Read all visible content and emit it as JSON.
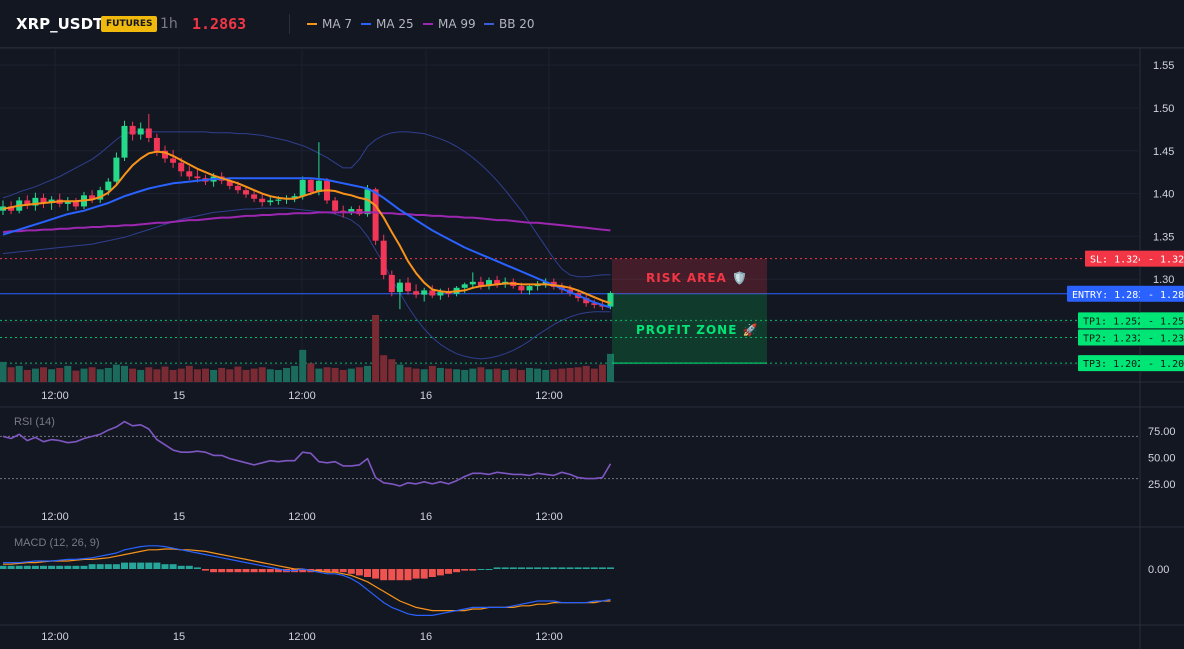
{
  "header": {
    "symbol": "XRP_USDT",
    "badge": "FUTURES",
    "timeframe": "1h",
    "price": "1.2863",
    "indicators": [
      {
        "label": "MA 7",
        "color": "#f7931a"
      },
      {
        "label": "MA 25",
        "color": "#2962ff"
      },
      {
        "label": "MA 99",
        "color": "#9c27b0"
      },
      {
        "label": "BB 20",
        "color": "#1e3a8a"
      }
    ]
  },
  "main_axis": {
    "ticks": [
      "1.55",
      "1.50",
      "1.45",
      "1.40",
      "1.35",
      "1.30",
      "1.25",
      "1.20"
    ]
  },
  "time_axis": {
    "ticks": [
      "12:00",
      "15",
      "12:00",
      "16",
      "12:00"
    ]
  },
  "levels": {
    "sl": {
      "tag": "SL: 1.324",
      "value": 1.324,
      "axis": "1.32",
      "color": "#f23645"
    },
    "entry": {
      "tag": "ENTRY: 1.283",
      "value": 1.283,
      "axis": "1.28",
      "color": "#2962ff"
    },
    "tp1": {
      "tag": "TP1: 1.252",
      "value": 1.252,
      "axis": "1.25",
      "color": "#00e676"
    },
    "tp2": {
      "tag": "TP2: 1.232",
      "value": 1.232,
      "axis": "1.23",
      "color": "#00e676"
    },
    "tp3": {
      "tag": "TP3: 1.202",
      "value": 1.202,
      "axis": "1.20",
      "color": "#00e676"
    }
  },
  "zones": {
    "risk_label": "RISK AREA 🛡️",
    "profit_label": "PROFIT ZONE 🚀"
  },
  "rsi": {
    "title": "RSI (14)",
    "ticks": [
      "75.00",
      "50.00",
      "25.00"
    ]
  },
  "macd": {
    "title": "MACD (12, 26, 9)",
    "ticks": [
      "0.00"
    ]
  },
  "chart_data": {
    "type": "candlestick",
    "candles": [
      [
        1.38,
        1.392,
        1.375,
        1.385
      ],
      [
        1.385,
        1.391,
        1.376,
        1.38
      ],
      [
        1.38,
        1.396,
        1.377,
        1.392
      ],
      [
        1.392,
        1.398,
        1.382,
        1.386
      ],
      [
        1.386,
        1.401,
        1.38,
        1.395
      ],
      [
        1.395,
        1.4,
        1.383,
        1.389
      ],
      [
        1.389,
        1.397,
        1.381,
        1.393
      ],
      [
        1.393,
        1.4,
        1.384,
        1.388
      ],
      [
        1.388,
        1.396,
        1.38,
        1.391
      ],
      [
        1.391,
        1.395,
        1.381,
        1.385
      ],
      [
        1.385,
        1.402,
        1.382,
        1.398
      ],
      [
        1.398,
        1.404,
        1.389,
        1.393
      ],
      [
        1.393,
        1.408,
        1.389,
        1.404
      ],
      [
        1.404,
        1.418,
        1.398,
        1.414
      ],
      [
        1.414,
        1.448,
        1.41,
        1.442
      ],
      [
        1.442,
        1.485,
        1.438,
        1.479
      ],
      [
        1.479,
        1.484,
        1.462,
        1.469
      ],
      [
        1.469,
        1.483,
        1.463,
        1.476
      ],
      [
        1.476,
        1.493,
        1.46,
        1.465
      ],
      [
        1.465,
        1.47,
        1.444,
        1.45
      ],
      [
        1.45,
        1.456,
        1.436,
        1.441
      ],
      [
        1.441,
        1.451,
        1.43,
        1.436
      ],
      [
        1.436,
        1.442,
        1.42,
        1.426
      ],
      [
        1.426,
        1.432,
        1.416,
        1.42
      ],
      [
        1.42,
        1.428,
        1.413,
        1.418
      ],
      [
        1.418,
        1.422,
        1.41,
        1.414
      ],
      [
        1.414,
        1.424,
        1.408,
        1.42
      ],
      [
        1.42,
        1.425,
        1.411,
        1.415
      ],
      [
        1.415,
        1.419,
        1.405,
        1.409
      ],
      [
        1.409,
        1.414,
        1.4,
        1.404
      ],
      [
        1.404,
        1.409,
        1.395,
        1.399
      ],
      [
        1.399,
        1.404,
        1.39,
        1.394
      ],
      [
        1.394,
        1.4,
        1.385,
        1.39
      ],
      [
        1.39,
        1.396,
        1.386,
        1.392
      ],
      [
        1.392,
        1.397,
        1.387,
        1.393
      ],
      [
        1.393,
        1.398,
        1.388,
        1.395
      ],
      [
        1.395,
        1.4,
        1.39,
        1.397
      ],
      [
        1.397,
        1.42,
        1.393,
        1.416
      ],
      [
        1.416,
        1.418,
        1.398,
        1.402
      ],
      [
        1.402,
        1.46,
        1.398,
        1.415
      ],
      [
        1.415,
        1.418,
        1.388,
        1.392
      ],
      [
        1.392,
        1.396,
        1.376,
        1.38
      ],
      [
        1.38,
        1.386,
        1.372,
        1.378
      ],
      [
        1.378,
        1.385,
        1.375,
        1.382
      ],
      [
        1.382,
        1.386,
        1.374,
        1.376
      ],
      [
        1.376,
        1.41,
        1.373,
        1.405
      ],
      [
        1.405,
        1.407,
        1.34,
        1.345
      ],
      [
        1.345,
        1.352,
        1.3,
        1.305
      ],
      [
        1.305,
        1.31,
        1.28,
        1.285
      ],
      [
        1.285,
        1.3,
        1.265,
        1.296
      ],
      [
        1.296,
        1.302,
        1.282,
        1.286
      ],
      [
        1.286,
        1.294,
        1.278,
        1.282
      ],
      [
        1.282,
        1.29,
        1.274,
        1.287
      ],
      [
        1.287,
        1.293,
        1.278,
        1.281
      ],
      [
        1.281,
        1.289,
        1.276,
        1.285
      ],
      [
        1.285,
        1.29,
        1.279,
        1.283
      ],
      [
        1.283,
        1.292,
        1.28,
        1.29
      ],
      [
        1.29,
        1.296,
        1.284,
        1.294
      ],
      [
        1.294,
        1.308,
        1.29,
        1.297
      ],
      [
        1.297,
        1.303,
        1.288,
        1.292
      ],
      [
        1.292,
        1.302,
        1.288,
        1.299
      ],
      [
        1.299,
        1.304,
        1.29,
        1.294
      ],
      [
        1.294,
        1.302,
        1.29,
        1.297
      ],
      [
        1.297,
        1.301,
        1.289,
        1.292
      ],
      [
        1.292,
        1.296,
        1.283,
        1.287
      ],
      [
        1.287,
        1.295,
        1.282,
        1.292
      ],
      [
        1.292,
        1.298,
        1.287,
        1.295
      ],
      [
        1.295,
        1.301,
        1.29,
        1.297
      ],
      [
        1.297,
        1.301,
        1.288,
        1.291
      ],
      [
        1.291,
        1.296,
        1.284,
        1.288
      ],
      [
        1.288,
        1.293,
        1.28,
        1.284
      ],
      [
        1.284,
        1.288,
        1.274,
        1.278
      ],
      [
        1.278,
        1.282,
        1.268,
        1.272
      ],
      [
        1.272,
        1.276,
        1.266,
        1.27
      ],
      [
        1.27,
        1.275,
        1.264,
        1.268
      ],
      [
        1.268,
        1.286,
        1.265,
        1.284
      ]
    ],
    "ma7": [
      1.382,
      1.384,
      1.386,
      1.387,
      1.388,
      1.389,
      1.39,
      1.391,
      1.391,
      1.391,
      1.392,
      1.393,
      1.396,
      1.401,
      1.41,
      1.422,
      1.433,
      1.441,
      1.447,
      1.449,
      1.448,
      1.444,
      1.439,
      1.434,
      1.429,
      1.425,
      1.421,
      1.418,
      1.415,
      1.412,
      1.408,
      1.404,
      1.4,
      1.397,
      1.395,
      1.394,
      1.394,
      1.397,
      1.4,
      1.403,
      1.404,
      1.403,
      1.4,
      1.398,
      1.395,
      1.393,
      1.386,
      1.372,
      1.355,
      1.339,
      1.321,
      1.307,
      1.296,
      1.288,
      1.286,
      1.285,
      1.286,
      1.287,
      1.29,
      1.292,
      1.293,
      1.294,
      1.295,
      1.295,
      1.294,
      1.294,
      1.294,
      1.294,
      1.293,
      1.292,
      1.29,
      1.287,
      1.283,
      1.279,
      1.275,
      1.272
    ],
    "ma25": [
      1.352,
      1.355,
      1.358,
      1.361,
      1.364,
      1.367,
      1.37,
      1.373,
      1.376,
      1.378,
      1.38,
      1.383,
      1.386,
      1.389,
      1.393,
      1.397,
      1.4,
      1.403,
      1.406,
      1.408,
      1.41,
      1.412,
      1.413,
      1.414,
      1.415,
      1.416,
      1.417,
      1.417,
      1.418,
      1.418,
      1.418,
      1.418,
      1.418,
      1.418,
      1.418,
      1.418,
      1.418,
      1.418,
      1.418,
      1.417,
      1.416,
      1.414,
      1.412,
      1.41,
      1.408,
      1.406,
      1.401,
      1.395,
      1.388,
      1.381,
      1.375,
      1.369,
      1.363,
      1.357,
      1.352,
      1.347,
      1.342,
      1.337,
      1.333,
      1.329,
      1.325,
      1.321,
      1.317,
      1.313,
      1.309,
      1.305,
      1.301,
      1.297,
      1.293,
      1.289,
      1.285,
      1.281,
      1.277,
      1.273,
      1.27,
      1.267
    ],
    "ma99": [
      1.355,
      1.356,
      1.356,
      1.357,
      1.357,
      1.358,
      1.358,
      1.359,
      1.359,
      1.36,
      1.36,
      1.361,
      1.361,
      1.362,
      1.362,
      1.363,
      1.363,
      1.364,
      1.365,
      1.366,
      1.366,
      1.367,
      1.368,
      1.369,
      1.369,
      1.37,
      1.371,
      1.372,
      1.372,
      1.373,
      1.374,
      1.374,
      1.375,
      1.375,
      1.376,
      1.376,
      1.377,
      1.377,
      1.377,
      1.378,
      1.378,
      1.378,
      1.378,
      1.378,
      1.378,
      1.378,
      1.378,
      1.377,
      1.377,
      1.376,
      1.376,
      1.375,
      1.375,
      1.374,
      1.374,
      1.373,
      1.373,
      1.372,
      1.372,
      1.371,
      1.37,
      1.369,
      1.369,
      1.368,
      1.367,
      1.366,
      1.366,
      1.365,
      1.364,
      1.363,
      1.362,
      1.361,
      1.36,
      1.359,
      1.358,
      1.357
    ],
    "bb_upper": [
      1.395,
      1.398,
      1.402,
      1.405,
      1.408,
      1.412,
      1.416,
      1.42,
      1.425,
      1.43,
      1.435,
      1.44,
      1.447,
      1.455,
      1.463,
      1.47,
      1.472,
      1.472,
      1.472,
      1.472,
      1.472,
      1.472,
      1.472,
      1.472,
      1.472,
      1.472,
      1.471,
      1.471,
      1.471,
      1.47,
      1.47,
      1.469,
      1.468,
      1.466,
      1.464,
      1.462,
      1.459,
      1.456,
      1.452,
      1.447,
      1.442,
      1.436,
      1.43,
      1.43,
      1.44,
      1.455,
      1.463,
      1.468,
      1.471,
      1.472,
      1.472,
      1.471,
      1.47,
      1.467,
      1.464,
      1.46,
      1.455,
      1.449,
      1.442,
      1.434,
      1.425,
      1.415,
      1.404,
      1.392,
      1.38,
      1.366,
      1.352,
      1.338,
      1.324,
      1.312,
      1.305,
      1.303,
      1.303,
      1.304,
      1.305,
      1.305
    ],
    "bb_lower": [
      1.33,
      1.331,
      1.332,
      1.333,
      1.334,
      1.335,
      1.336,
      1.337,
      1.338,
      1.339,
      1.34,
      1.341,
      1.343,
      1.345,
      1.347,
      1.349,
      1.352,
      1.355,
      1.358,
      1.361,
      1.364,
      1.367,
      1.37,
      1.372,
      1.374,
      1.376,
      1.378,
      1.379,
      1.38,
      1.381,
      1.382,
      1.382,
      1.383,
      1.383,
      1.383,
      1.383,
      1.382,
      1.381,
      1.38,
      1.379,
      1.378,
      1.376,
      1.373,
      1.369,
      1.362,
      1.35,
      1.334,
      1.318,
      1.3,
      1.284,
      1.268,
      1.254,
      1.242,
      1.232,
      1.224,
      1.218,
      1.213,
      1.21,
      1.208,
      1.207,
      1.208,
      1.21,
      1.213,
      1.217,
      1.222,
      1.228,
      1.235,
      1.241,
      1.247,
      1.252,
      1.256,
      1.259,
      1.261,
      1.262,
      1.262,
      1.262
    ],
    "volume": [
      0.3,
      0.22,
      0.24,
      0.18,
      0.2,
      0.22,
      0.19,
      0.21,
      0.24,
      0.17,
      0.2,
      0.22,
      0.19,
      0.21,
      0.26,
      0.24,
      0.2,
      0.18,
      0.22,
      0.19,
      0.23,
      0.18,
      0.2,
      0.24,
      0.19,
      0.2,
      0.18,
      0.21,
      0.19,
      0.23,
      0.18,
      0.2,
      0.22,
      0.19,
      0.18,
      0.21,
      0.24,
      0.48,
      0.28,
      0.2,
      0.22,
      0.21,
      0.18,
      0.2,
      0.22,
      0.24,
      1.0,
      0.4,
      0.34,
      0.26,
      0.22,
      0.2,
      0.19,
      0.24,
      0.21,
      0.2,
      0.19,
      0.18,
      0.2,
      0.22,
      0.19,
      0.2,
      0.18,
      0.2,
      0.18,
      0.21,
      0.2,
      0.18,
      0.19,
      0.2,
      0.21,
      0.22,
      0.24,
      0.2,
      0.26,
      0.42
    ],
    "rsi": [
      70,
      68,
      72,
      66,
      69,
      65,
      67,
      66,
      64,
      65,
      68,
      70,
      72,
      76,
      79,
      84,
      80,
      81,
      77,
      67,
      62,
      57,
      55,
      55,
      56,
      55,
      52,
      52,
      49,
      47,
      45,
      43,
      45,
      47,
      46,
      47,
      47,
      55,
      54,
      46,
      45,
      46,
      42,
      42,
      43,
      49,
      31,
      26,
      25,
      23,
      26,
      25,
      27,
      25,
      27,
      25,
      28,
      32,
      35,
      35,
      34,
      36,
      35,
      34,
      34,
      33,
      35,
      34,
      33,
      36,
      34,
      31,
      30,
      30,
      31,
      44
    ],
    "macd": [
      0.004,
      0.004,
      0.004,
      0.0045,
      0.005,
      0.005,
      0.005,
      0.0055,
      0.006,
      0.006,
      0.0065,
      0.007,
      0.008,
      0.009,
      0.01,
      0.012,
      0.013,
      0.014,
      0.0145,
      0.0145,
      0.014,
      0.013,
      0.012,
      0.011,
      0.01,
      0.009,
      0.008,
      0.007,
      0.006,
      0.005,
      0.004,
      0.003,
      0.002,
      0.001,
      0.0,
      -0.001,
      -0.001,
      0.0,
      -0.001,
      -0.002,
      -0.003,
      -0.003,
      -0.004,
      -0.006,
      -0.009,
      -0.013,
      -0.017,
      -0.021,
      -0.024,
      -0.026,
      -0.028,
      -0.029,
      -0.029,
      -0.029,
      -0.028,
      -0.027,
      -0.026,
      -0.025,
      -0.024,
      -0.024,
      -0.024,
      -0.024,
      -0.024,
      -0.023,
      -0.022,
      -0.021,
      -0.02,
      -0.02,
      -0.02,
      -0.021,
      -0.021,
      -0.021,
      -0.021,
      -0.02,
      -0.02,
      -0.019
    ],
    "signal": [
      0.003,
      0.003,
      0.0035,
      0.004,
      0.004,
      0.0045,
      0.005,
      0.005,
      0.005,
      0.0055,
      0.006,
      0.006,
      0.0065,
      0.007,
      0.008,
      0.009,
      0.01,
      0.011,
      0.012,
      0.012,
      0.0125,
      0.0125,
      0.012,
      0.012,
      0.0115,
      0.011,
      0.01,
      0.009,
      0.008,
      0.007,
      0.006,
      0.005,
      0.004,
      0.003,
      0.002,
      0.001,
      0.0,
      0.0,
      -0.001,
      -0.001,
      -0.002,
      -0.002,
      -0.003,
      -0.004,
      -0.006,
      -0.008,
      -0.011,
      -0.014,
      -0.017,
      -0.02,
      -0.022,
      -0.024,
      -0.025,
      -0.026,
      -0.026,
      -0.026,
      -0.026,
      -0.026,
      -0.025,
      -0.025,
      -0.024,
      -0.024,
      -0.024,
      -0.024,
      -0.023,
      -0.023,
      -0.022,
      -0.022,
      -0.021,
      -0.021,
      -0.021,
      -0.021,
      -0.021,
      -0.021,
      -0.02,
      -0.02
    ],
    "hist": [
      0.002,
      0.002,
      0.002,
      0.002,
      0.002,
      0.002,
      0.002,
      0.002,
      0.002,
      0.002,
      0.002,
      0.003,
      0.003,
      0.003,
      0.003,
      0.004,
      0.004,
      0.004,
      0.004,
      0.004,
      0.003,
      0.003,
      0.002,
      0.002,
      0.001,
      -0.001,
      -0.002,
      -0.002,
      -0.002,
      -0.002,
      -0.002,
      -0.002,
      -0.002,
      -0.002,
      -0.002,
      -0.002,
      -0.002,
      -0.002,
      -0.002,
      -0.002,
      -0.002,
      -0.002,
      -0.002,
      -0.003,
      -0.004,
      -0.005,
      -0.006,
      -0.007,
      -0.007,
      -0.007,
      -0.007,
      -0.006,
      -0.006,
      -0.005,
      -0.004,
      -0.003,
      -0.002,
      -0.001,
      -0.001,
      0.0,
      0.0,
      0.001,
      0.001,
      0.001,
      0.001,
      0.001,
      0.001,
      0.001,
      0.001,
      0.001,
      0.001,
      0.001,
      0.001,
      0.001,
      0.001,
      0.001
    ]
  }
}
